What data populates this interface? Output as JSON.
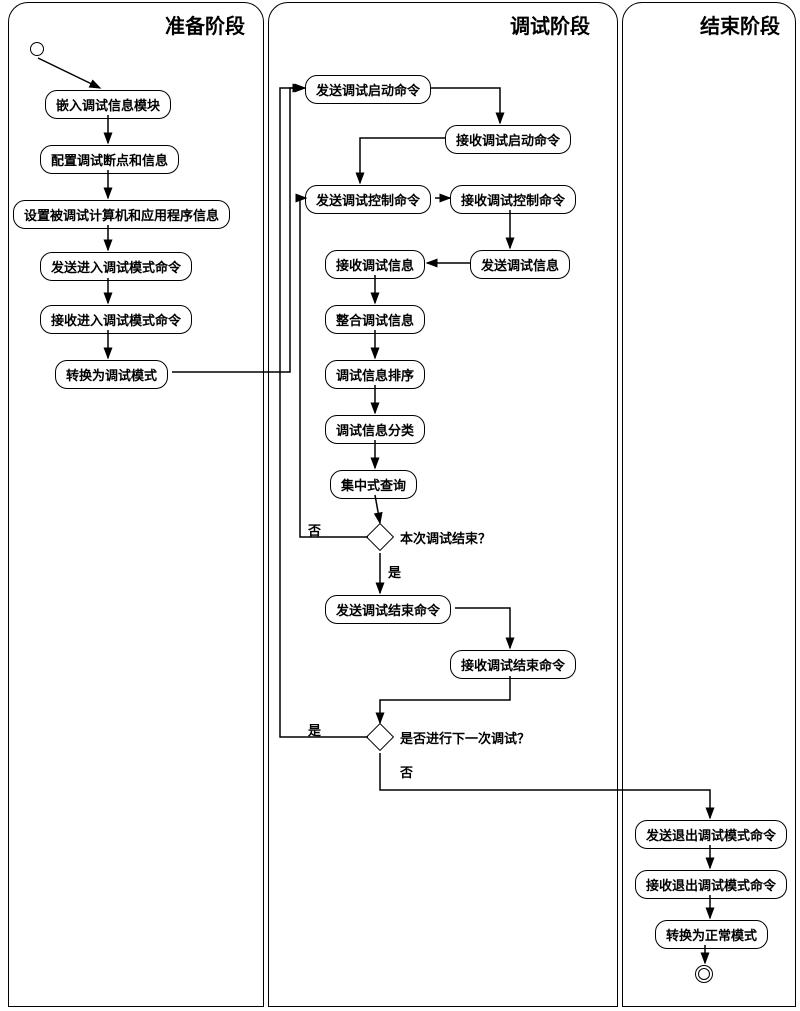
{
  "headers": {
    "prep": "准备阶段",
    "debug": "调试阶段",
    "end": "结束阶段"
  },
  "boxes": {
    "p1": "嵌入调试信息模块",
    "p2": "配置调试断点和信息",
    "p3": "设置被调试计算机和应用程序信息",
    "p4": "发送进入调试模式命令",
    "p5": "接收进入调试模式命令",
    "p6": "转换为调试模式",
    "d1": "发送调试启动命令",
    "d2": "接收调试启动命令",
    "d3": "发送调试控制命令",
    "d4": "接收调试控制命令",
    "d5": "接收调试信息",
    "d6": "发送调试信息",
    "d7": "整合调试信息",
    "d8": "调试信息排序",
    "d9": "调试信息分类",
    "d10": "集中式查询",
    "d11": "发送调试结束命令",
    "d12": "接收调试结束命令",
    "e1": "发送退出调试模式命令",
    "e2": "接收退出调试模式命令",
    "e3": "转换为正常模式"
  },
  "decisions": {
    "q1": "本次调试结束？",
    "q2": "是否进行下一次调试？"
  },
  "labels": {
    "yes": "是",
    "no": "否"
  }
}
